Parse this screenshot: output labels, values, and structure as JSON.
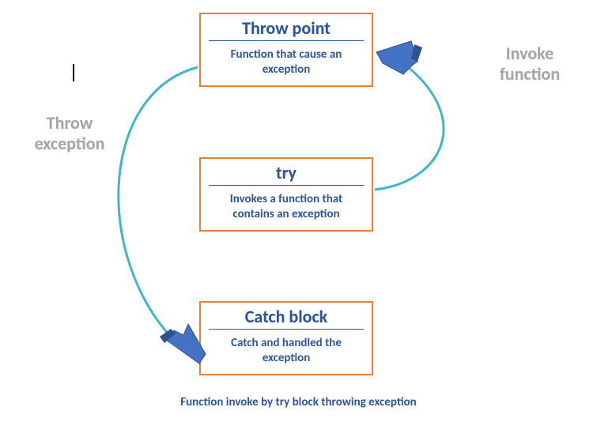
{
  "boxes": {
    "throw_point": {
      "title": "Throw point",
      "desc": "Function that cause an exception"
    },
    "try": {
      "title": "try",
      "desc": "Invokes a function that contains an exception"
    },
    "catch": {
      "title": "Catch block",
      "desc": "Catch and handled the exception"
    }
  },
  "labels": {
    "invoke": "Invoke function",
    "throw": "Throw exception"
  },
  "caption": "Function invoke by try  block throwing exception",
  "colors": {
    "box_border": "#ed7d31",
    "text_blue": "#2f5597",
    "label_gray": "#a6a6a6",
    "arrow_stroke": "#41b6c8",
    "arrow_fill": "#4472c4"
  }
}
